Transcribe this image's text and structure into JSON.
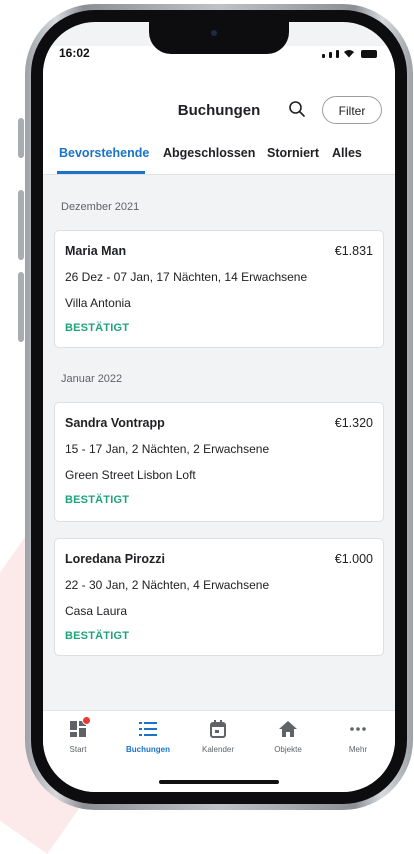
{
  "status_bar": {
    "time": "16:02"
  },
  "header": {
    "title": "Buchungen",
    "filter_label": "Filter",
    "tabs": [
      {
        "label": "Bevorstehende",
        "active": true
      },
      {
        "label": "Abgeschlossen",
        "active": false
      },
      {
        "label": "Storniert",
        "active": false
      },
      {
        "label": "Alles",
        "active": false
      }
    ]
  },
  "sections": [
    {
      "label": "Dezember 2021",
      "bookings": [
        {
          "name": "Maria Man",
          "price": "€1.831",
          "dates": "26 Dez - 07 Jan, 17 Nächten, 14 Erwachsene",
          "property": "Villa Antonia",
          "status": "BESTÄTIGT"
        }
      ]
    },
    {
      "label": "Januar 2022",
      "bookings": [
        {
          "name": "Sandra Vontrapp",
          "price": "€1.320",
          "dates": "15 - 17 Jan, 2 Nächten, 2 Erwachsene",
          "property": "Green Street Lisbon Loft",
          "status": "BESTÄTIGT"
        },
        {
          "name": "Loredana Pirozzi",
          "price": "€1.000",
          "dates": "22 - 30 Jan, 2 Nächten, 4 Erwachsene",
          "property": "Casa Laura",
          "status": "BESTÄTIGT"
        }
      ]
    }
  ],
  "tabbar": [
    {
      "label": "Start",
      "icon": "dashboard-icon",
      "active": false
    },
    {
      "label": "Buchungen",
      "icon": "list-icon",
      "active": true
    },
    {
      "label": "Kalender",
      "icon": "calendar-icon",
      "active": false
    },
    {
      "label": "Objekte",
      "icon": "home-icon",
      "active": false
    },
    {
      "label": "Mehr",
      "icon": "more-icon",
      "active": false
    }
  ],
  "colors": {
    "accent": "#1a73c8",
    "status_confirmed": "#1ea37a",
    "badge": "#e53935"
  }
}
